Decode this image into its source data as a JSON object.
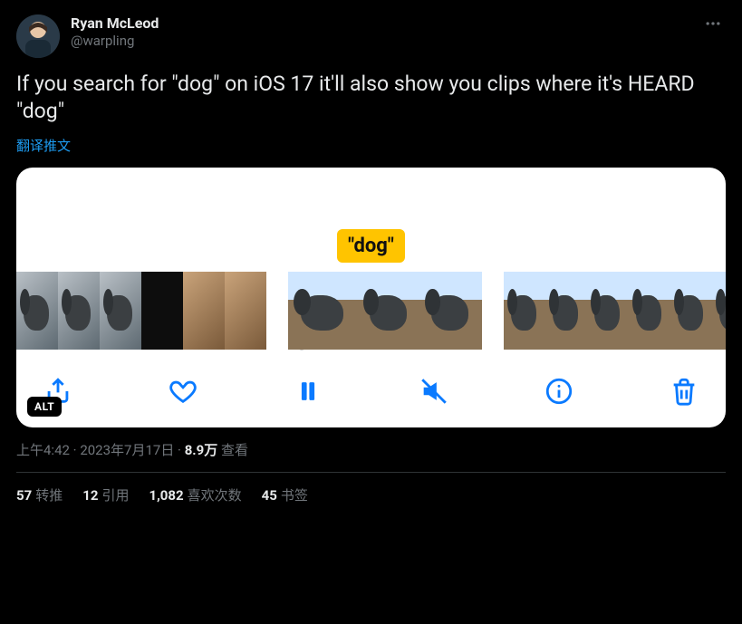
{
  "author": {
    "display_name": "Ryan McLeod",
    "handle": "@warpling"
  },
  "tweet_text": "If you search for \"dog\" on iOS 17 it'll also show you clips where it's HEARD \"dog\"",
  "translate_label": "翻译推文",
  "media": {
    "caption": "\"dog\"",
    "alt_badge": "ALT"
  },
  "meta": {
    "time": "上午4:42",
    "date": "2023年7月17日",
    "views_count": "8.9万",
    "views_label": "查看"
  },
  "stats": {
    "retweets": {
      "count": "57",
      "label": "转推"
    },
    "quotes": {
      "count": "12",
      "label": "引用"
    },
    "likes": {
      "count": "1,082",
      "label": "喜欢次数"
    },
    "bookmarks": {
      "count": "45",
      "label": "书签"
    }
  }
}
